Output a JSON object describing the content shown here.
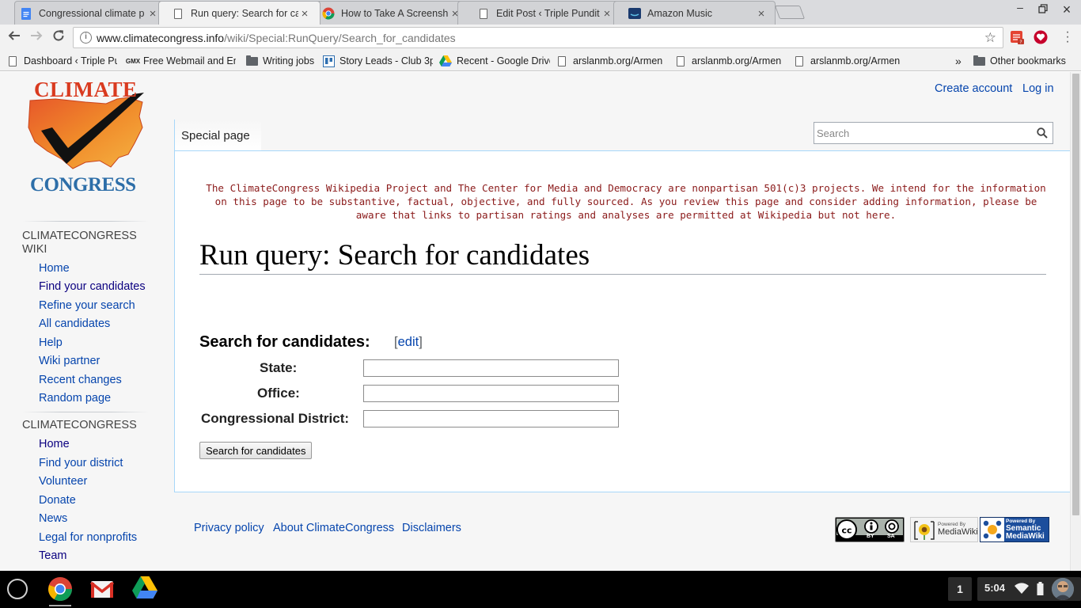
{
  "browser": {
    "tabs": [
      {
        "title": "Congressional climate p",
        "icon": "google-docs-icon",
        "active": false
      },
      {
        "title": "Run query: Search for ca",
        "icon": "page-icon",
        "active": true
      },
      {
        "title": "How to Take A Screensh",
        "icon": "chrome-icon",
        "active": false
      },
      {
        "title": "Edit Post ‹ Triple Pundit",
        "icon": "page-icon",
        "active": false
      },
      {
        "title": "Amazon Music",
        "icon": "amazon-music-icon",
        "active": false
      }
    ],
    "address": {
      "host": "www.climatecongress.info",
      "path": "/wiki/Special:RunQuery/Search_for_candidates"
    },
    "bookmarks": [
      {
        "label": "Dashboard ‹ Triple Pu",
        "icon": "page-icon"
      },
      {
        "label": "Free Webmail and Em",
        "icon": "gmx-icon"
      },
      {
        "label": "Writing jobs",
        "icon": "folder-icon"
      },
      {
        "label": "Story Leads - Club 3p",
        "icon": "trello-icon"
      },
      {
        "label": "Recent - Google Drive",
        "icon": "google-drive-icon"
      },
      {
        "label": "arslanmb.org/Armen",
        "icon": "page-icon"
      },
      {
        "label": "arslanmb.org/Armen",
        "icon": "page-icon"
      },
      {
        "label": "arslanmb.org/Armen",
        "icon": "page-icon"
      }
    ],
    "bookmarks_overflow": "»",
    "other_bookmarks": "Other bookmarks"
  },
  "logo": {
    "top": "CLIMATE",
    "bottom": "CONGRESS"
  },
  "sidebar": {
    "section1": {
      "heading": "CLIMATECONGRESS WIKI",
      "items": [
        "Home",
        "Find your candidates",
        "Refine your search",
        "All candidates",
        "Help",
        "Wiki partner",
        "Recent changes",
        "Random page"
      ]
    },
    "section2": {
      "heading": "CLIMATECONGRESS",
      "items": [
        "Home",
        "Find your district",
        "Volunteer",
        "Donate",
        "News",
        "Legal for nonprofits",
        "Team"
      ]
    }
  },
  "personal": {
    "create_account": "Create account",
    "login": "Log in"
  },
  "namespace_tab": "Special page",
  "search": {
    "placeholder": "Search"
  },
  "notice": "The ClimateCongress Wikipedia Project and The Center for Media and Democracy are nonpartisan 501(c)3 projects. We intend for the information on this page to be substantive, factual, objective, and fully sourced. As you review this page and consider adding information, please be aware that links to partisan ratings and analyses are permitted at Wikipedia but not here.",
  "page_title": "Run query: Search for candidates",
  "form": {
    "heading": "Search for candidates:",
    "edit_open": "[",
    "edit_label": "edit",
    "edit_close": "]",
    "fields": [
      {
        "label": "State:",
        "value": ""
      },
      {
        "label": "Office:",
        "value": ""
      },
      {
        "label": "Congressional District:",
        "value": ""
      }
    ],
    "submit": "Search for candidates"
  },
  "footer": {
    "links": [
      "Privacy policy",
      "About ClimateCongress",
      "Disclaimers"
    ],
    "badges": {
      "cc_by": "BY",
      "cc_sa": "SA",
      "mediawiki_top": "Powered By",
      "mediawiki_bottom": "MediaWiki",
      "smw_top": "Powered By",
      "smw_mid": "Semantic",
      "smw_bottom": "MediaWiki"
    }
  },
  "shelf": {
    "notification_count": "1",
    "time": "5:04"
  }
}
